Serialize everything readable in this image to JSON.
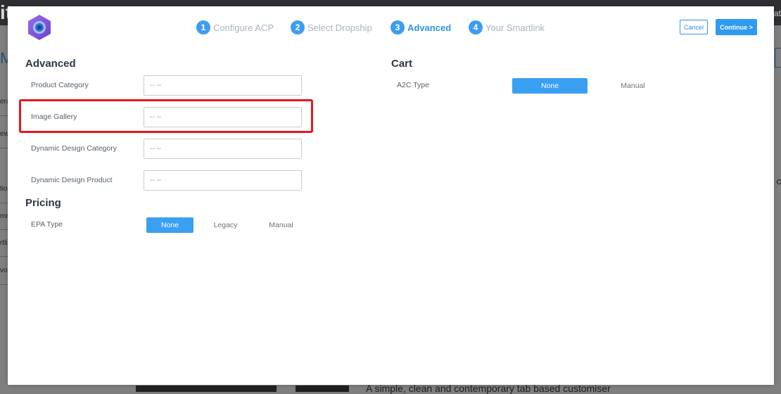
{
  "background": {
    "logo_fragment": "it",
    "top_right_fragment": "at",
    "heading_fragment": "Ma",
    "sidebar_fragments": [
      "era",
      "ew",
      "tio",
      "mn",
      "rtli",
      "vor"
    ],
    "right_text_fragment": "t c",
    "bottom_text": "A simple, clean and contemporary tab based customiser"
  },
  "header": {
    "logo_icon": "app-hexagon-logo-icon",
    "steps": [
      {
        "number": "1",
        "label": "Configure ACP",
        "active": false
      },
      {
        "number": "2",
        "label": "Select Dropship",
        "active": false
      },
      {
        "number": "3",
        "label": "Advanced",
        "active": true
      },
      {
        "number": "4",
        "label": "Your Smartlink",
        "active": false
      }
    ],
    "cancel_label": "Cancel",
    "continue_label": "Continue >"
  },
  "advanced": {
    "title": "Advanced",
    "fields": [
      {
        "label": "Product Category",
        "placeholder": "-- --"
      },
      {
        "label": "Image Gallery",
        "placeholder": "-- --"
      },
      {
        "label": "Dynamic Design Category",
        "placeholder": "-- --"
      },
      {
        "label": "Dynamic Design Product",
        "placeholder": "-- --"
      }
    ]
  },
  "pricing": {
    "title": "Pricing",
    "epa_label": "EPA Type",
    "options": [
      "None",
      "Legacy",
      "Manual"
    ],
    "selected": "None"
  },
  "cart": {
    "title": "Cart",
    "a2c_label": "A2C Type",
    "options": [
      "None",
      "Manual"
    ],
    "selected": "None"
  },
  "colors": {
    "accent": "#2f92ea",
    "highlight": "#e8161b"
  }
}
